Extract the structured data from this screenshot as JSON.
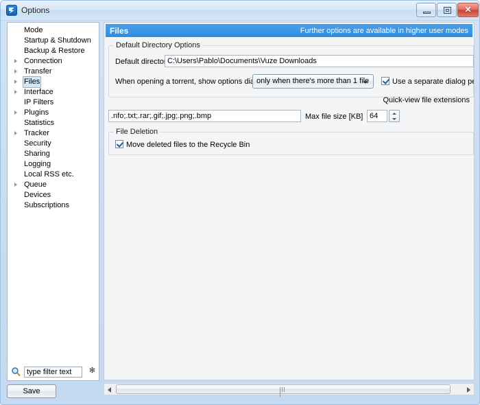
{
  "window": {
    "title": "Options",
    "icon": "vuze-logo-icon",
    "buttons": {
      "minimize": "minimize-button",
      "maximize": "maximize-button",
      "close_glyph": "✕"
    }
  },
  "sidebar": {
    "items": [
      {
        "label": "Mode",
        "expandable": false,
        "selected": false
      },
      {
        "label": "Startup & Shutdown",
        "expandable": false,
        "selected": false
      },
      {
        "label": "Backup & Restore",
        "expandable": false,
        "selected": false
      },
      {
        "label": "Connection",
        "expandable": true,
        "selected": false
      },
      {
        "label": "Transfer",
        "expandable": true,
        "selected": false
      },
      {
        "label": "Files",
        "expandable": true,
        "selected": true
      },
      {
        "label": "Interface",
        "expandable": true,
        "selected": false
      },
      {
        "label": "IP Filters",
        "expandable": false,
        "selected": false
      },
      {
        "label": "Plugins",
        "expandable": true,
        "selected": false
      },
      {
        "label": "Statistics",
        "expandable": false,
        "selected": false
      },
      {
        "label": "Tracker",
        "expandable": true,
        "selected": false
      },
      {
        "label": "Security",
        "expandable": false,
        "selected": false
      },
      {
        "label": "Sharing",
        "expandable": false,
        "selected": false
      },
      {
        "label": "Logging",
        "expandable": false,
        "selected": false
      },
      {
        "label": "Local RSS etc.",
        "expandable": false,
        "selected": false
      },
      {
        "label": "Queue",
        "expandable": true,
        "selected": false
      },
      {
        "label": "Devices",
        "expandable": false,
        "selected": false
      },
      {
        "label": "Subscriptions",
        "expandable": false,
        "selected": false
      }
    ]
  },
  "filter": {
    "placeholder": "type filter text",
    "value": "",
    "clear_glyph": "✻",
    "icon": "search-icon"
  },
  "save": {
    "label": "Save"
  },
  "panel": {
    "title": "Files",
    "note": "Further options are available in higher user modes",
    "header_bg": "#2f8ce0",
    "groups": {
      "default_directory": {
        "title": "Default Directory Options",
        "directory_label": "Default directory:",
        "directory_value": "C:\\Users\\Pablo\\Documents\\Vuze Downloads",
        "torrent_dialog_label": "When opening a torrent, show options dialog:",
        "torrent_dialog_value": "only when there's more than 1 file",
        "separate_dialog_label": "Use a separate dialog per t",
        "separate_dialog_checked": true
      },
      "quick_view": {
        "heading": "Quick-view file extensions",
        "extensions_value": ".nfo;.txt;.rar;.gif;.jpg;.png;.bmp",
        "max_size_label": "Max file size [KB]",
        "max_size_value": "64"
      },
      "file_deletion": {
        "title": "File Deletion",
        "recycle_label": "Move deleted files to the Recycle Bin",
        "recycle_checked": true
      }
    }
  },
  "scrollbar": {
    "left_arrow": "scroll-left-arrow",
    "right_arrow": "scroll-right-arrow"
  }
}
